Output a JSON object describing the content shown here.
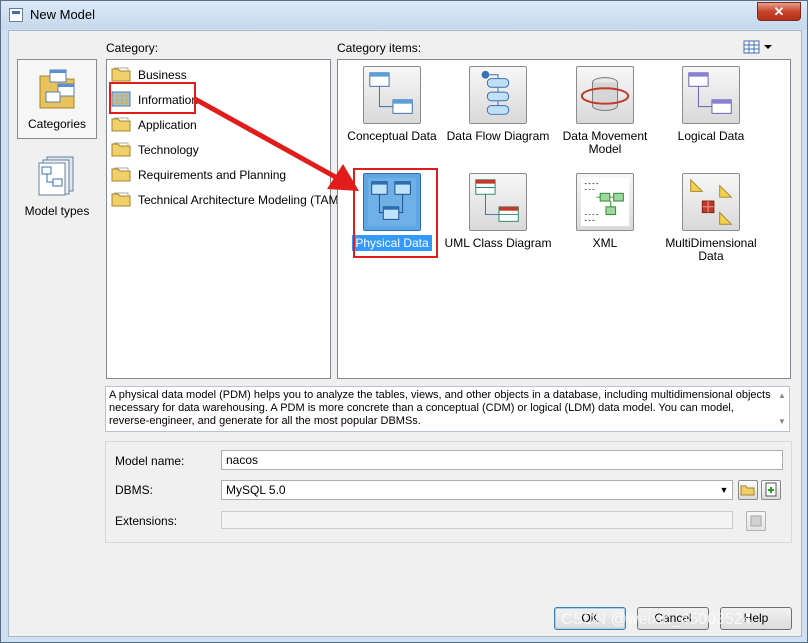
{
  "window": {
    "title": "New Model",
    "close_glyph": "✕"
  },
  "nav": [
    {
      "label": "Categories",
      "icon": "categories-icon",
      "selected": true
    },
    {
      "label": "Model types",
      "icon": "model-types-icon",
      "selected": false
    }
  ],
  "category": {
    "header": "Category:",
    "items": [
      "Business",
      "Information",
      "Application",
      "Technology",
      "Requirements and Planning",
      "Technical Architecture Modeling (TAM)"
    ],
    "highlighted": "Information"
  },
  "category_items": {
    "header": "Category items:",
    "items": [
      {
        "label": "Conceptual Data",
        "icon": "conceptual-data-icon"
      },
      {
        "label": "Data Flow Diagram",
        "icon": "data-flow-diagram-icon"
      },
      {
        "label": "Data Movement Model",
        "icon": "data-movement-model-icon"
      },
      {
        "label": "Logical Data",
        "icon": "logical-data-icon"
      },
      {
        "label": "Physical Data",
        "icon": "physical-data-icon",
        "selected": true
      },
      {
        "label": "UML Class Diagram",
        "icon": "uml-class-diagram-icon"
      },
      {
        "label": "XML",
        "icon": "xml-icon"
      },
      {
        "label": "MultiDimensional Data",
        "icon": "multidimensional-data-icon"
      }
    ]
  },
  "description": "A physical data model (PDM) helps you to analyze the tables, views, and other objects in a database, including multidimensional objects necessary for data warehousing. A PDM is more concrete than a conceptual (CDM) or logical (LDM) data model. You can model, reverse-engineer, and generate for all the most popular DBMSs.",
  "form": {
    "model_name_label": "Model name:",
    "model_name_value": "nacos",
    "dbms_label": "DBMS:",
    "dbms_value": "MySQL 5.0",
    "extensions_label": "Extensions:",
    "extensions_value": ""
  },
  "buttons": {
    "ok": "OK",
    "cancel": "Cancel",
    "help": "Help"
  },
  "watermark": "CSDN @weixin_45003524",
  "colors": {
    "selection": "#3399ff",
    "annotation": "#e21b1b",
    "window_frame": "#cfe0f1"
  }
}
